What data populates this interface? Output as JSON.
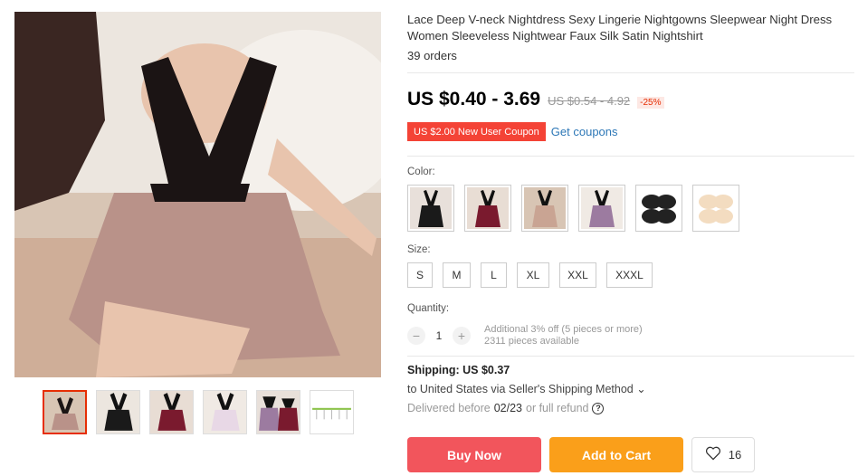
{
  "product": {
    "title": "Lace Deep V-neck Nightdress Sexy Lingerie Nightgowns Sleepwear Night Dress Women Sleeveless Nightwear Faux Silk Satin Nightshirt",
    "orders": "39 orders"
  },
  "price": {
    "current": "US $0.40 - 3.69",
    "original": "US $0.54 - 4.92",
    "discount": "-25%"
  },
  "coupon": {
    "tag": "US $2.00 New User Coupon",
    "link": "Get coupons"
  },
  "color": {
    "label": "Color:",
    "options": [
      {
        "name": "black",
        "color": "#1a1a1a"
      },
      {
        "name": "wine-red",
        "color": "#7a1a2e"
      },
      {
        "name": "pink-black",
        "color": "#c9a493"
      },
      {
        "name": "purple",
        "color": "#9c7ba0"
      },
      {
        "name": "black-pads",
        "color": "#222222"
      },
      {
        "name": "nude-pads",
        "color": "#f3dcc0"
      }
    ]
  },
  "size": {
    "label": "Size:",
    "options": [
      "S",
      "M",
      "L",
      "XL",
      "XXL",
      "XXXL"
    ]
  },
  "quantity": {
    "label": "Quantity:",
    "value": "1",
    "minus": "−",
    "plus": "+",
    "discount_note": "Additional 3% off (5 pieces or more)",
    "available": "2311 pieces available"
  },
  "shipping": {
    "label": "Shipping:",
    "price": "US $0.37",
    "destination": "to United States via Seller's Shipping Method",
    "chevron": "⌄",
    "delivered_prefix": "Delivered before",
    "delivered_date": "02/23",
    "delivered_suffix": "or full refund",
    "help": "?"
  },
  "actions": {
    "buy_now": "Buy Now",
    "add_to_cart": "Add to Cart",
    "wishlist_count": "16"
  },
  "colors": {
    "accent_red": "#f2555c",
    "accent_orange": "#fa9f1a",
    "coupon_red": "#f44336",
    "link_blue": "#2e78b7"
  }
}
